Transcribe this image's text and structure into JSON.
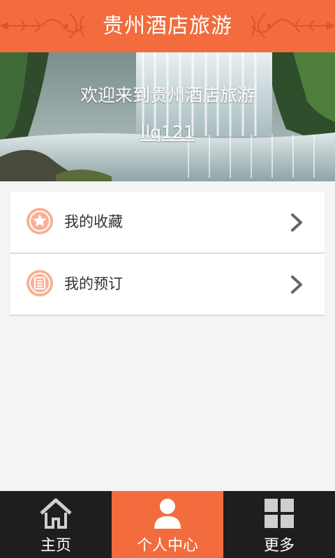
{
  "header": {
    "title": "贵州酒店旅游"
  },
  "banner": {
    "welcome_text": "欢迎来到贵州酒店旅游",
    "username": "llq121"
  },
  "menu": {
    "items": [
      {
        "label": "我的收藏",
        "icon": "star-icon"
      },
      {
        "label": "我的预订",
        "icon": "list-icon"
      }
    ]
  },
  "tabbar": {
    "tabs": [
      {
        "label": "主页",
        "icon": "home-icon",
        "active": false
      },
      {
        "label": "个人中心",
        "icon": "user-icon",
        "active": true
      },
      {
        "label": "更多",
        "icon": "grid-icon",
        "active": false
      }
    ]
  },
  "colors": {
    "accent": "#f26c3d",
    "icon_bg": "#f8b095",
    "tabbar_bg": "#1f1d1d",
    "page_bg": "#f4f4f4"
  }
}
